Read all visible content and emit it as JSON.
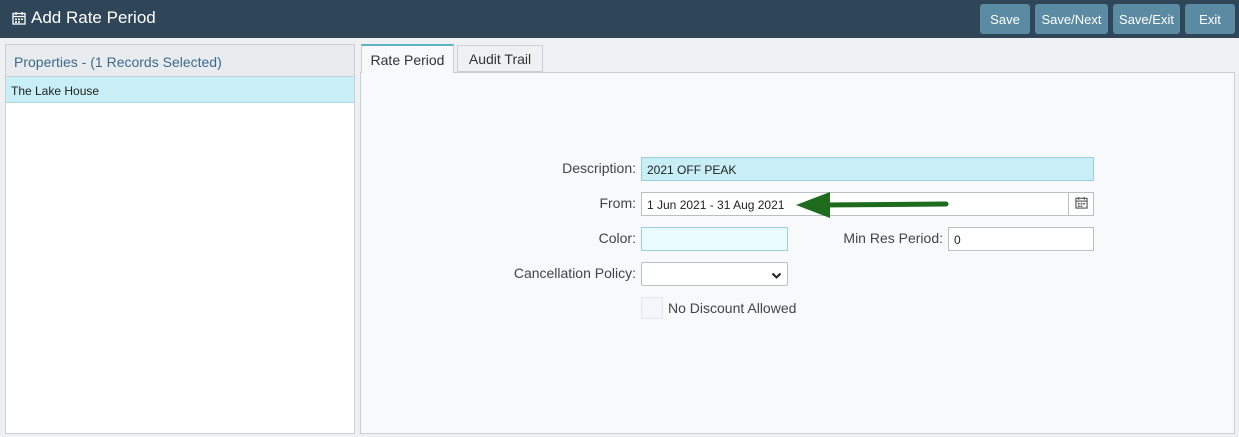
{
  "header": {
    "title": "Add Rate Period",
    "title_icon": "calendar-icon",
    "buttons": {
      "save": "Save",
      "save_next": "Save/Next",
      "save_exit": "Save/Exit",
      "exit": "Exit"
    }
  },
  "properties_panel": {
    "header": "Properties - (1 Records Selected)",
    "items": [
      {
        "label": "The Lake House",
        "selected": true
      }
    ]
  },
  "tabs": [
    {
      "label": "Rate Period",
      "active": true
    },
    {
      "label": "Audit Trail",
      "active": false
    }
  ],
  "form": {
    "description": {
      "label": "Description:",
      "value": "2021 OFF PEAK"
    },
    "from": {
      "label": "From:",
      "value": "1 Jun 2021 - 31 Aug 2021",
      "icon": "calendar-icon"
    },
    "color": {
      "label": "Color:",
      "value": ""
    },
    "min_res_period": {
      "label": "Min Res Period:",
      "value": "0"
    },
    "cancellation_policy": {
      "label": "Cancellation Policy:",
      "value": ""
    },
    "no_discount": {
      "label": "No Discount Allowed",
      "checked": false
    }
  },
  "annotation": {
    "arrow_color": "#1e6b1e",
    "arrow_icon": "arrow-left-icon"
  },
  "colors": {
    "header_bg": "#2f4558",
    "button_bg": "#5b8aa3",
    "highlight": "#c8eef6"
  }
}
